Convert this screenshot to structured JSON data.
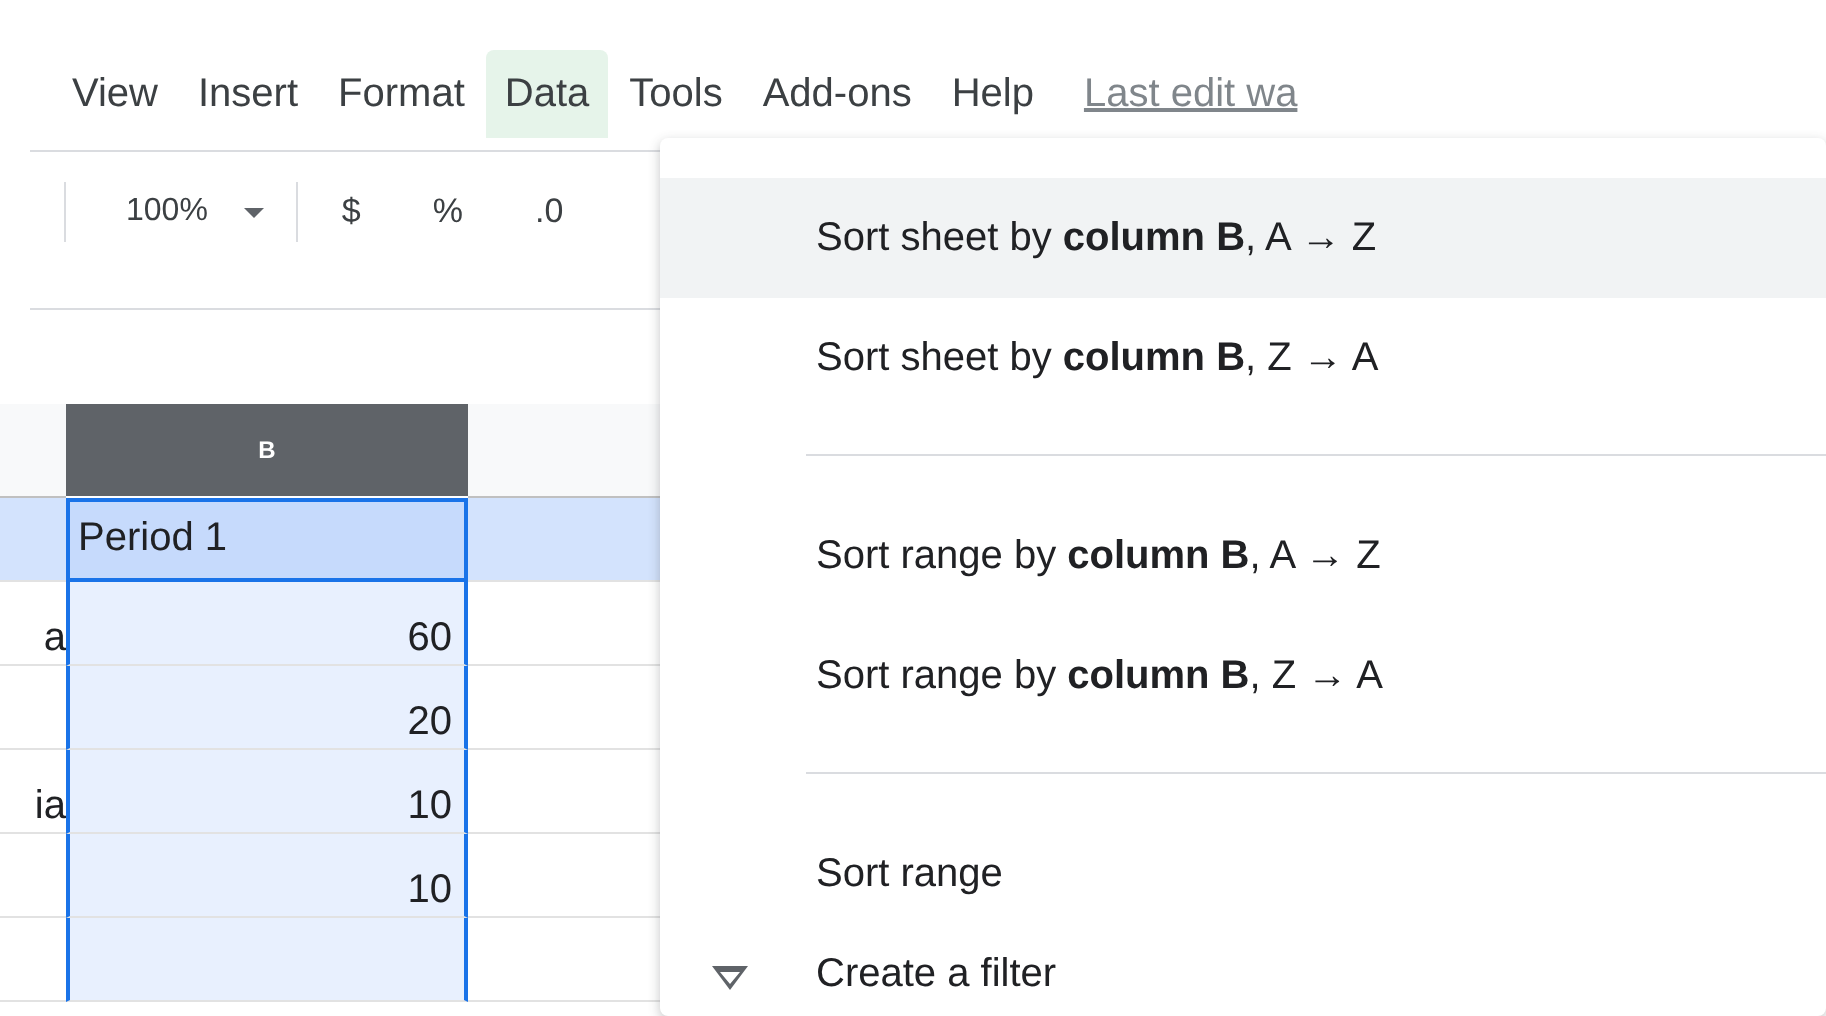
{
  "menu_bar": {
    "items": [
      {
        "label": "View",
        "selected": false
      },
      {
        "label": "Insert",
        "selected": false
      },
      {
        "label": "Format",
        "selected": false
      },
      {
        "label": "Data",
        "selected": true
      },
      {
        "label": "Tools",
        "selected": false
      },
      {
        "label": "Add-ons",
        "selected": false
      },
      {
        "label": "Help",
        "selected": false
      }
    ],
    "last_edit": "Last edit wa"
  },
  "toolbar": {
    "zoom": "100%",
    "buttons": [
      "$",
      "%",
      ".0"
    ]
  },
  "sheet": {
    "column_header": "B",
    "rows": [
      {
        "column_b": "Period 1",
        "selected": true
      },
      {
        "column_a": "a",
        "column_b": "60",
        "selected": false
      },
      {
        "column_b": "20",
        "selected": false
      },
      {
        "column_a": "ia",
        "column_b": "10",
        "selected": false
      },
      {
        "column_b": "10",
        "selected": false
      },
      {
        "selected": false
      }
    ]
  },
  "data_menu": {
    "items": [
      {
        "kind": "item",
        "label": "Sort sheet by **column B**, A → Z",
        "selected": true
      },
      {
        "kind": "item",
        "label": "Sort sheet by **column B**, Z → A",
        "selected": false
      },
      {
        "kind": "divider"
      },
      {
        "kind": "item",
        "label": "Sort range by **column B**, A → Z",
        "selected": false
      },
      {
        "kind": "item",
        "label": "Sort range by **column B**, Z → A",
        "selected": false
      },
      {
        "kind": "divider"
      },
      {
        "kind": "item",
        "label": "Sort range",
        "selected": false
      },
      {
        "kind": "filter",
        "label": "Create a filter",
        "selected": false
      }
    ]
  }
}
